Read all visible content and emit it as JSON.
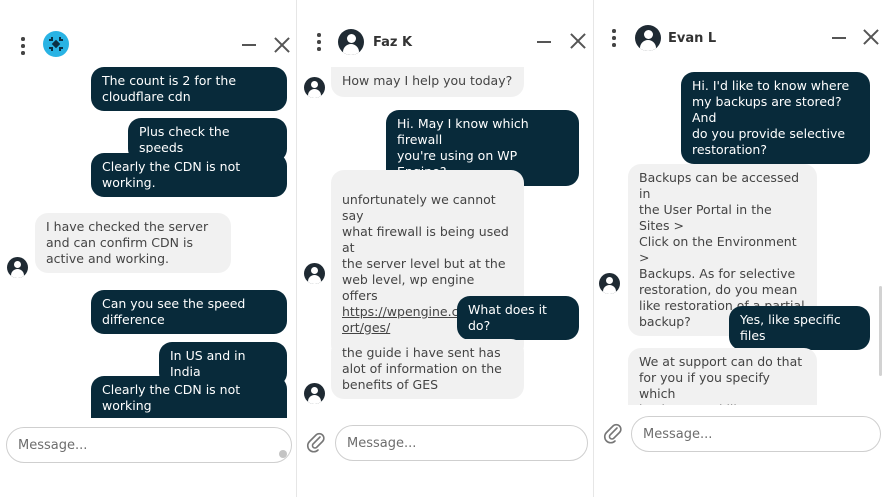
{
  "panels": [
    {
      "contact": "",
      "messages": [
        "The count is 2 for the\ncloudflare cdn",
        "Plus check the speeds",
        "Clearly the CDN is not\nworking.",
        "I have checked the server\nand can confirm CDN is\nactive and working.",
        "Can you see the speed\ndifference",
        "In US and in India",
        "Clearly the CDN is not\nworking"
      ],
      "input_placeholder": "Message..."
    },
    {
      "contact": "Faz K",
      "messages": [
        "How may I help you today?",
        "Hi. May I know which firewall\nyou're using on WP Engine?",
        "unfortunately we cannot say\nwhat firewall is being used at\nthe server level but at the\nweb level, wp engine offers",
        "https://wpengine.com/supp\nort/ges/",
        "What does it do?",
        "the guide i have sent has\nalot of information on the\nbenefits of GES"
      ],
      "input_placeholder": "Message..."
    },
    {
      "contact": "Evan L",
      "messages": [
        "Hi. I'd like to know where\nmy backups are stored? And\ndo you provide selective\nrestoration?",
        "Backups can be accessed in\nthe User Portal in the Sites >\nClick on the Environment >\nBackups. As for selective\nrestoration, do you mean\nlike restoration of a partial\nbackup?",
        "Yes, like specific files",
        "We at support can do that\nfor you if you specify which\nbackup you'd like to use and"
      ],
      "input_placeholder": "Message..."
    }
  ],
  "colors": {
    "outgoing_bubble": "#082a3a",
    "incoming_bubble": "#f1f1f1",
    "logo": "#29b3e4"
  },
  "icons": [
    "more-vertical-icon",
    "minimize-icon",
    "close-icon",
    "user-avatar-icon",
    "paperclip-icon",
    "brand-logo-icon"
  ]
}
